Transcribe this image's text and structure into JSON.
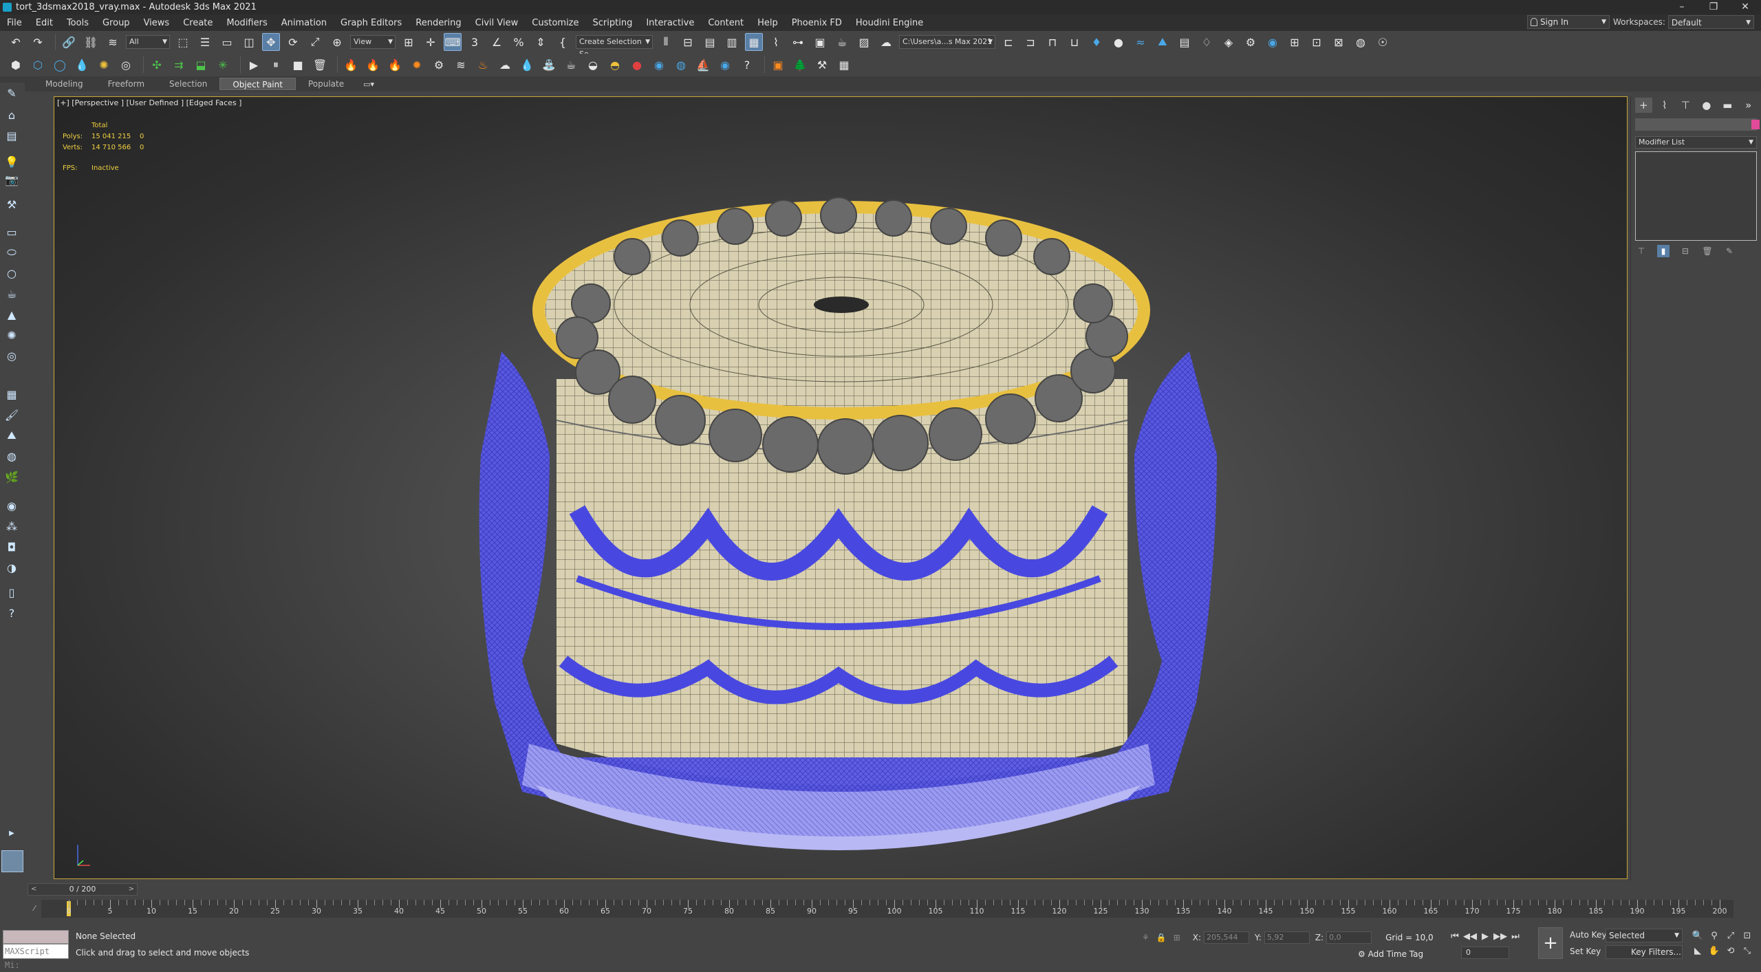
{
  "window": {
    "title": "tort_3dsmax2018_vray.max - Autodesk 3ds Max 2021",
    "controls": [
      "–",
      "❐",
      "✕"
    ]
  },
  "menu": [
    "File",
    "Edit",
    "Tools",
    "Group",
    "Views",
    "Create",
    "Modifiers",
    "Animation",
    "Graph Editors",
    "Rendering",
    "Civil View",
    "Customize",
    "Scripting",
    "Interactive",
    "Content",
    "Help",
    "Phoenix FD",
    "Houdini Engine"
  ],
  "account": {
    "sign_in": "Sign In"
  },
  "workspaces": {
    "label": "Workspaces:",
    "value": "Default"
  },
  "toolbar": {
    "filter": "All",
    "ref_coord": "View",
    "selection_set": "Create Selection Se",
    "project_path": "C:\\Users\\a...s Max 2021"
  },
  "ribbon": {
    "tabs": [
      "Modeling",
      "Freeform",
      "Selection",
      "Object Paint",
      "Populate"
    ],
    "active_tab": "Object Paint"
  },
  "viewport": {
    "label": "[+] [Perspective ] [User Defined ] [Edged Faces ]",
    "stats": {
      "header": "Total",
      "polys_label": "Polys:",
      "polys_total": "15 041 215",
      "polys_sel": "0",
      "verts_label": "Verts:",
      "verts_total": "14 710 566",
      "verts_sel": "0",
      "fps_label": "FPS:",
      "fps_value": "Inactive"
    },
    "colors": {
      "frame": "#c8a838",
      "stats_text": "#f0d040",
      "deco_blue": "#5a5ae8",
      "ring_yellow": "#e8c040",
      "cream": "#d8d0b0",
      "swirl": "#6a6a6a"
    }
  },
  "command_panel": {
    "modifier_list": "Modifier List",
    "swatch_color": "#e24a9a"
  },
  "timeline": {
    "time_slider": "0 / 200",
    "ticks": [
      "0",
      "5",
      "10",
      "15",
      "20",
      "25",
      "30",
      "35",
      "40",
      "45",
      "50",
      "55",
      "60",
      "65",
      "70",
      "75",
      "80",
      "85",
      "90",
      "95",
      "100",
      "105",
      "110",
      "115",
      "120",
      "125",
      "130",
      "135",
      "140",
      "145",
      "150",
      "155",
      "160",
      "165",
      "170",
      "175",
      "180",
      "185",
      "190",
      "195",
      "200"
    ],
    "max_frame": 200,
    "current_frame": 0
  },
  "status": {
    "maxscript": "MAXScript Mi:",
    "selection": "None Selected",
    "prompt": "Click and drag to select and move objects",
    "x_label": "X:",
    "x_value": "205,544",
    "y_label": "Y:",
    "y_value": "5,92",
    "z_label": "Z:",
    "z_value": "0,0",
    "grid": "Grid = 10,0",
    "add_time_tag": "Add Time Tag",
    "frame": "0",
    "auto_key": "Auto Key",
    "set_key": "Set Key",
    "selected": "Selected",
    "key_filters": "Key Filters..."
  }
}
